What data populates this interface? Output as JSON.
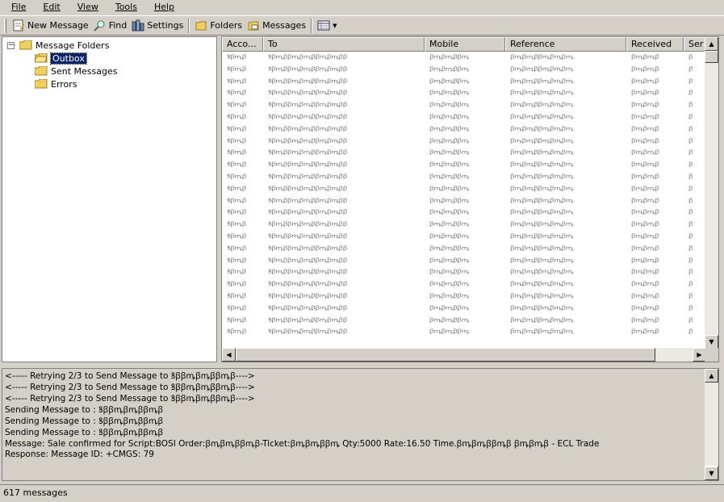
{
  "menu": {
    "items": [
      "File",
      "Edit",
      "View",
      "Tools",
      "Help"
    ]
  },
  "toolbar": {
    "new_message": "New Message",
    "find": "Find",
    "settings": "Settings",
    "folders": "Folders",
    "messages": "Messages"
  },
  "tree": {
    "root": "Message Folders",
    "expander": "−",
    "items": [
      "Outbox",
      "Sent Messages",
      "Errors"
    ]
  },
  "list": {
    "columns": [
      "Acco...",
      "To",
      "Mobile",
      "Reference",
      "Received",
      "Ser"
    ],
    "row_count_visible": 24
  },
  "log": {
    "lines": [
      "<----- Retrying 2/3 to Send Message to ꝸꞵꞵꝳꞵꝳꞵꞵꝳꞵ---->",
      "<----- Retrying 2/3 to Send Message to ꝸꞵꞵꝳꞵꝳꞵꞵꝳꞵ---->",
      "<----- Retrying 2/3 to Send Message to ꝸꞵꞵꝳꞵꝳꞵꞵꝳꞵ---->",
      "Sending Message to : ꝸꞵꞵꝳꞵꝳꞵꞵꝳꞵ",
      "Sending Message to : ꝸꞵꞵꝳꞵꝳꞵꞵꝳꞵ",
      "Sending Message to : ꝸꞵꞵꝳꞵꝳꞵꞵꝳꞵ",
      "Message: Sale confirmed for Script:BOSI Order:ꞵꝳꞵꝳꞵꞵꝳꞵ-Ticket:ꞵꝳꞵꝳꞵꞵꝳ Qty:5000 Rate:16.50 Time.ꞵꝳꞵꝳꞵꞵꝳꞵ ꞵꝳꞵꝳꞵ - ECL Trade",
      "Response: Message ID: +CMGS: 79"
    ]
  },
  "status": {
    "text": "617 messages"
  },
  "colors": {
    "selection": "#0a246a",
    "chrome": "#d4d0c8",
    "folder": "#f0d060"
  }
}
